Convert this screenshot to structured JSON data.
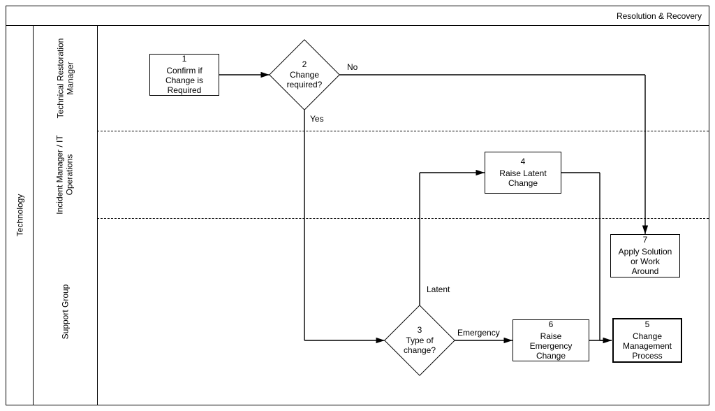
{
  "diagram": {
    "title": "Resolution & Recovery",
    "mainLane": "Technology",
    "lanes": {
      "a": "Technical Restoration\nManager",
      "b": "Incident Manager / IT\nOperations",
      "c": "Support Group"
    },
    "nodes": {
      "n1": {
        "num": "1",
        "text": "Confirm if\nChange is\nRequired"
      },
      "n2": {
        "num": "2",
        "text": "Change\nrequired?"
      },
      "n3": {
        "num": "3",
        "text": "Type of\nchange?"
      },
      "n4": {
        "num": "4",
        "text": "Raise Latent\nChange"
      },
      "n5": {
        "num": "5",
        "text": "Change\nManagement\nProcess"
      },
      "n6": {
        "num": "6",
        "text": "Raise\nEmergency\nChange"
      },
      "n7": {
        "num": "7",
        "text": "Apply Solution\nor Work\nAround"
      }
    },
    "labels": {
      "no": "No",
      "yes": "Yes",
      "latent": "Latent",
      "emergency": "Emergency"
    }
  },
  "chart_data": {
    "type": "diagram",
    "title": "Resolution & Recovery",
    "swimlanes": {
      "group": "Technology",
      "lanes": [
        "Technical Restoration Manager",
        "Incident Manager / IT Operations",
        "Support Group"
      ]
    },
    "nodes": [
      {
        "id": 1,
        "lane": "Technical Restoration Manager",
        "type": "process",
        "label": "Confirm if Change is Required"
      },
      {
        "id": 2,
        "lane": "Technical Restoration Manager",
        "type": "decision",
        "label": "Change required?"
      },
      {
        "id": 3,
        "lane": "Support Group",
        "type": "decision",
        "label": "Type of change?"
      },
      {
        "id": 4,
        "lane": "Incident Manager / IT Operations",
        "type": "process",
        "label": "Raise Latent Change"
      },
      {
        "id": 5,
        "lane": "Support Group",
        "type": "process",
        "label": "Change Management Process"
      },
      {
        "id": 6,
        "lane": "Support Group",
        "type": "process",
        "label": "Raise Emergency Change"
      },
      {
        "id": 7,
        "lane": "Support Group",
        "type": "process",
        "label": "Apply Solution or Work Around"
      }
    ],
    "edges": [
      {
        "from": 1,
        "to": 2,
        "label": ""
      },
      {
        "from": 2,
        "to": 7,
        "label": "No"
      },
      {
        "from": 2,
        "to": 3,
        "label": "Yes"
      },
      {
        "from": 3,
        "to": 4,
        "label": "Latent"
      },
      {
        "from": 3,
        "to": 6,
        "label": "Emergency"
      },
      {
        "from": 4,
        "to": 5,
        "label": ""
      },
      {
        "from": 6,
        "to": 5,
        "label": ""
      }
    ]
  }
}
